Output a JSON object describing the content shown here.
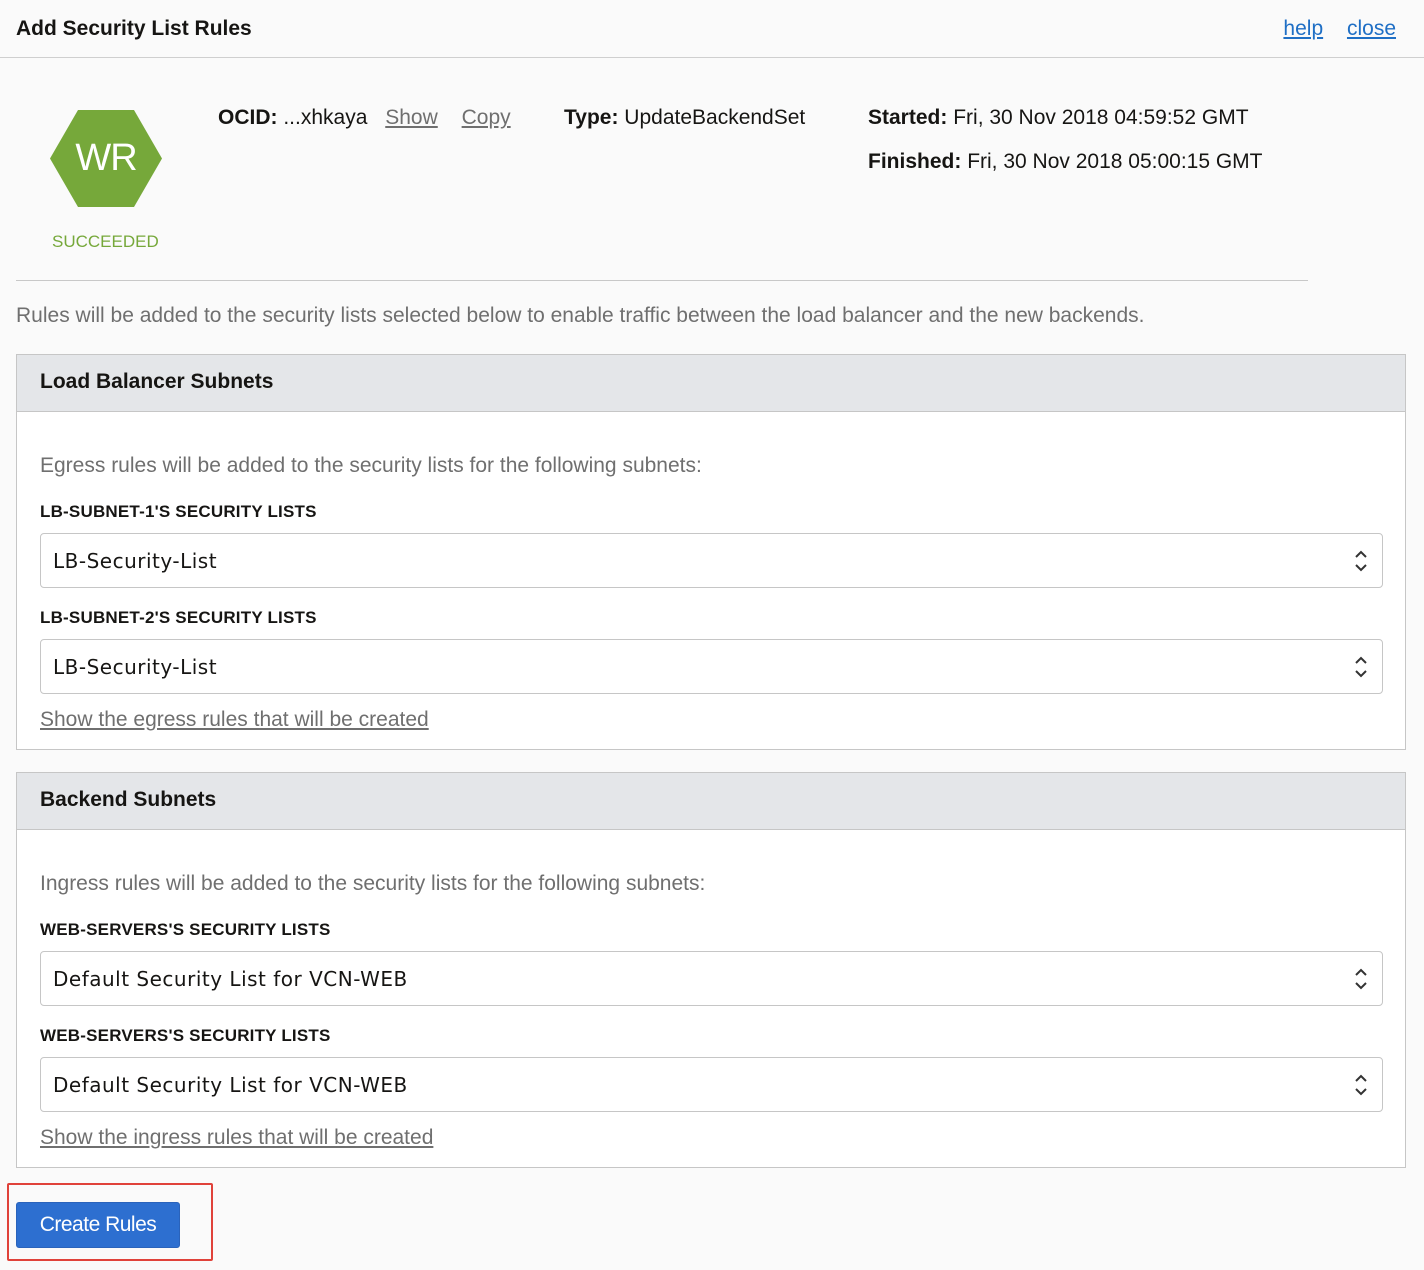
{
  "dialog": {
    "title": "Add Security List Rules",
    "help_link": "help",
    "close_link": "close"
  },
  "work_request": {
    "icon_text": "WR",
    "icon_color": "#76a83a",
    "state": "SUCCEEDED",
    "ocid_label": "OCID:",
    "ocid_value": "...xhkaya",
    "show_link": "Show",
    "copy_link": "Copy",
    "type_label": "Type:",
    "type_value": "UpdateBackendSet",
    "started_label": "Started:",
    "started_value": "Fri, 30 Nov 2018 04:59:52 GMT",
    "finished_label": "Finished:",
    "finished_value": "Fri, 30 Nov 2018 05:00:15 GMT"
  },
  "intro_text": "Rules will be added to the security lists selected below to enable traffic between the load balancer and the new backends.",
  "lb_panel": {
    "title": "Load Balancer Subnets",
    "description": "Egress rules will be added to the security lists for the following subnets:",
    "fields": [
      {
        "label": "LB-SUBNET-1'S SECURITY LISTS",
        "value": "LB-Security-List"
      },
      {
        "label": "LB-SUBNET-2'S SECURITY LISTS",
        "value": "LB-Security-List"
      }
    ],
    "show_link": "Show the egress rules that will be created"
  },
  "backend_panel": {
    "title": "Backend Subnets",
    "description": "Ingress rules will be added to the security lists for the following subnets:",
    "fields": [
      {
        "label": "WEB-SERVERS'S SECURITY LISTS",
        "value": "Default Security List for VCN-WEB"
      },
      {
        "label": "WEB-SERVERS'S SECURITY LISTS",
        "value": "Default Security List for VCN-WEB"
      }
    ],
    "show_link": "Show the ingress rules that will be created"
  },
  "create_button": "Create Rules",
  "colors": {
    "accent": "#2d6fd0",
    "success": "#76a83a",
    "highlight": "#e0423a"
  }
}
